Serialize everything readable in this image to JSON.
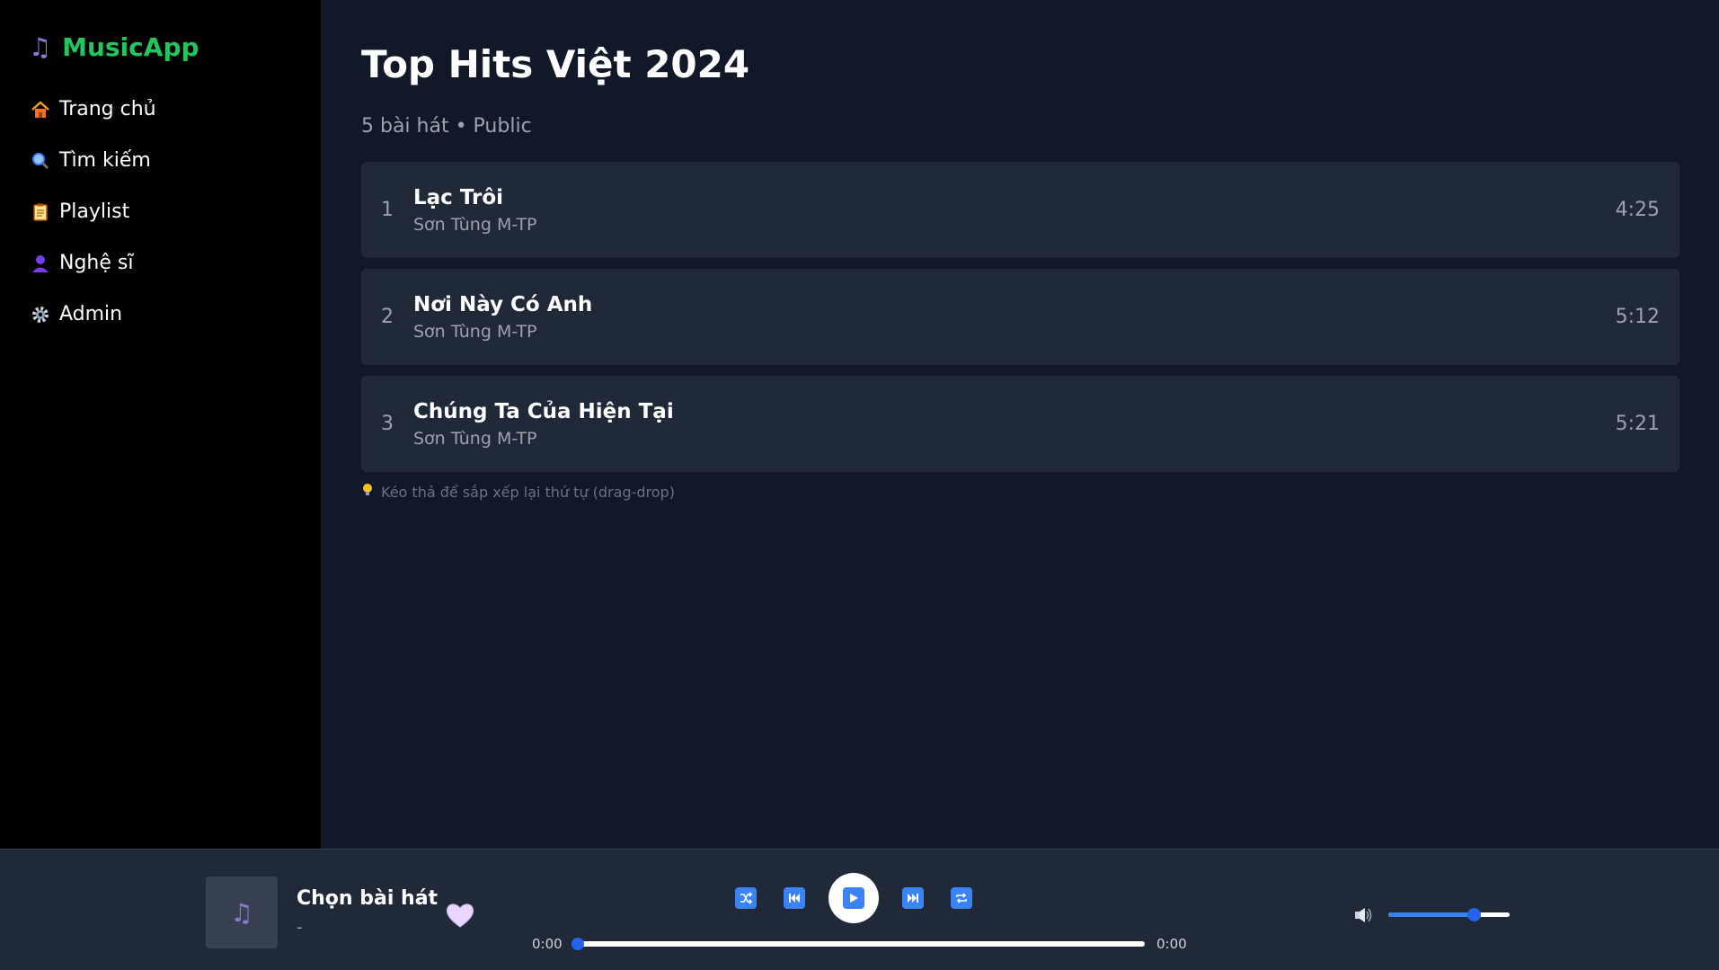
{
  "app": {
    "name": "MusicApp",
    "brand_color": "#22c55e"
  },
  "sidebar": {
    "items": [
      {
        "label": "Trang chủ",
        "icon": "home-icon"
      },
      {
        "label": "Tìm kiếm",
        "icon": "search-icon"
      },
      {
        "label": "Playlist",
        "icon": "clipboard-icon"
      },
      {
        "label": "Nghệ sĩ",
        "icon": "person-icon"
      },
      {
        "label": "Admin",
        "icon": "gear-icon"
      }
    ]
  },
  "playlist": {
    "title": "Top Hits Việt 2024",
    "meta": "5 bài hát • Public",
    "tracks": [
      {
        "number": "1",
        "title": "Lạc Trôi",
        "artist": "Sơn Tùng M-TP",
        "duration": "4:25"
      },
      {
        "number": "2",
        "title": "Nơi Này Có Anh",
        "artist": "Sơn Tùng M-TP",
        "duration": "5:12"
      },
      {
        "number": "3",
        "title": "Chúng Ta Của Hiện Tại",
        "artist": "Sơn Tùng M-TP",
        "duration": "5:21"
      }
    ],
    "hint": "Kéo thả để sắp xếp lại thứ tự (drag-drop)"
  },
  "player": {
    "title": "Chọn bài hát",
    "artist": "-",
    "current_time": "0:00",
    "total_time": "0:00",
    "progress": 0,
    "volume": 0.7,
    "accent_color": "#3b82f6"
  }
}
